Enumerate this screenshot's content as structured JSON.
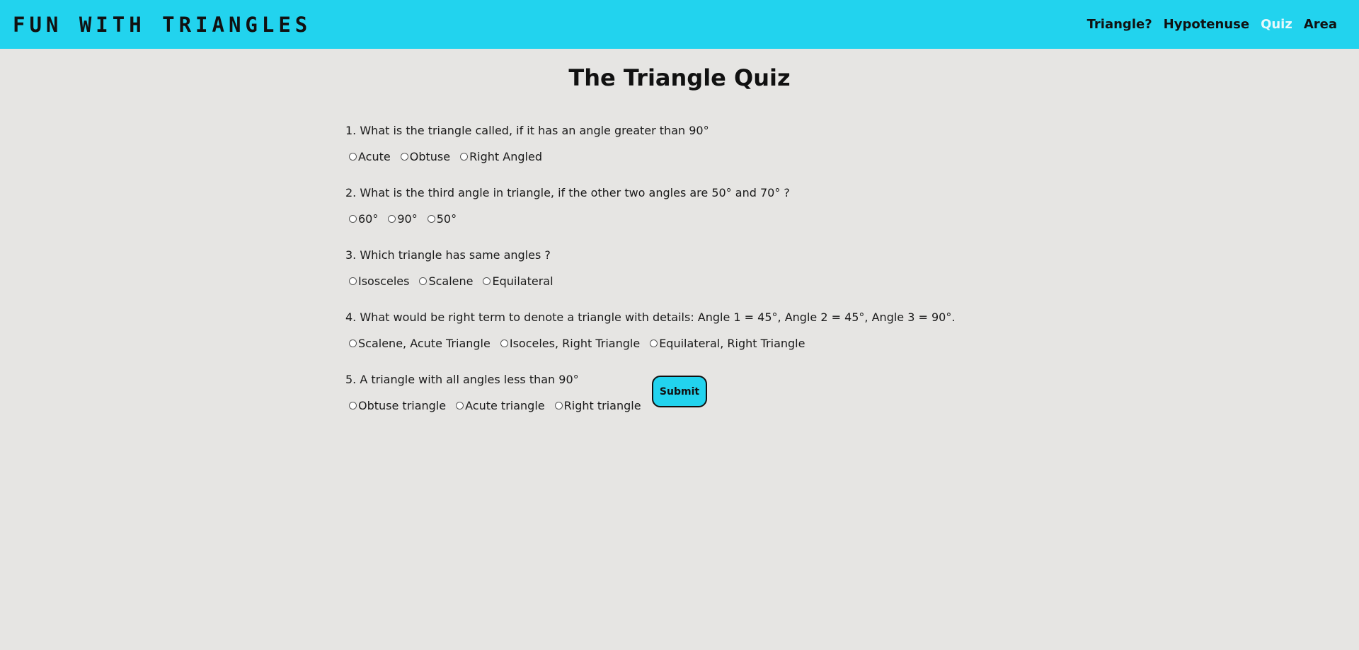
{
  "nav": {
    "brand": "Fun with triangles",
    "links": [
      "Triangle?",
      "Hypotenuse",
      "Quiz",
      "Area"
    ],
    "active_link": "Quiz"
  },
  "main": {
    "title": "The Triangle Quiz",
    "questions": [
      {
        "text": "1. What is the triangle called, if it has an angle greater than 90°",
        "options": [
          "Acute",
          "Obtuse",
          "Right Angled"
        ]
      },
      {
        "text": "2. What is the third angle in triangle, if the other two angles are 50° and 70° ?",
        "options": [
          "60°",
          "90°",
          "50°"
        ]
      },
      {
        "text": "3. Which triangle has same angles ?",
        "options": [
          "Isosceles",
          "Scalene",
          "Equilateral"
        ]
      },
      {
        "text": "4. What would be right term to denote a triangle with details: Angle 1 = 45°, Angle 2 = 45°, Angle 3 = 90°.",
        "options": [
          "Scalene, Acute Triangle",
          "Isoceles, Right Triangle",
          "Equilateral, Right Triangle"
        ]
      },
      {
        "text": "5. A triangle with all angles less than 90°",
        "options": [
          "Obtuse triangle",
          "Acute triangle",
          "Right triangle"
        ]
      }
    ],
    "submit_label": "Submit"
  },
  "colors": {
    "nav_bg": "#22d3ee",
    "page_bg": "#e6e5e3",
    "active_link": "#e8f8fb",
    "button_bg": "#22d3ee"
  }
}
